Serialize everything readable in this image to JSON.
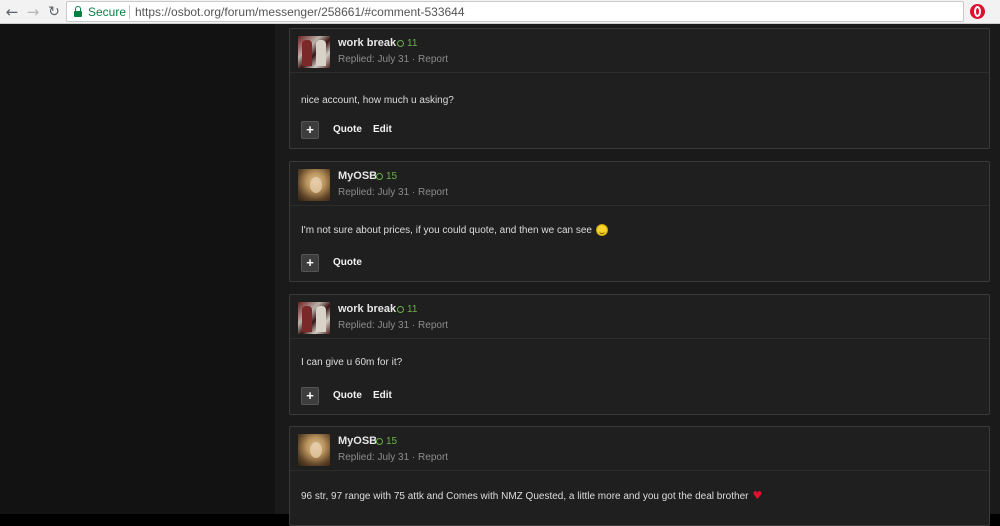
{
  "browser": {
    "secure_label": "Secure",
    "url": "https://osbot.org/forum/messenger/258661/#comment-533644"
  },
  "posts": [
    {
      "username": "work break",
      "reputation": "11",
      "meta": "Replied: July 31 · Report",
      "body": "nice account, how much u asking?",
      "actions": {
        "plus": "+",
        "quote": "Quote",
        "edit": "Edit"
      }
    },
    {
      "username": "MyOSB",
      "reputation": "15",
      "meta": "Replied: July 31 · Report",
      "body": "I'm not sure about prices, if you could quote, and then we can see",
      "emoji": "smiley-icon",
      "actions": {
        "plus": "+",
        "quote": "Quote"
      }
    },
    {
      "username": "work break",
      "reputation": "11",
      "meta": "Replied: July 31 · Report",
      "body": "I can give u 60m for it?",
      "actions": {
        "plus": "+",
        "quote": "Quote",
        "edit": "Edit"
      }
    },
    {
      "username": "MyOSB",
      "reputation": "15",
      "meta": "Replied: July 31 · Report",
      "body": "96 str, 97 range with 75 attk and Comes with NMZ Quested, a little more and you got the deal brother",
      "emoji": "heart-icon"
    }
  ],
  "colors": {
    "reputation": "#6ab04c",
    "secure": "#0b8043",
    "heart": "#e0102f"
  }
}
